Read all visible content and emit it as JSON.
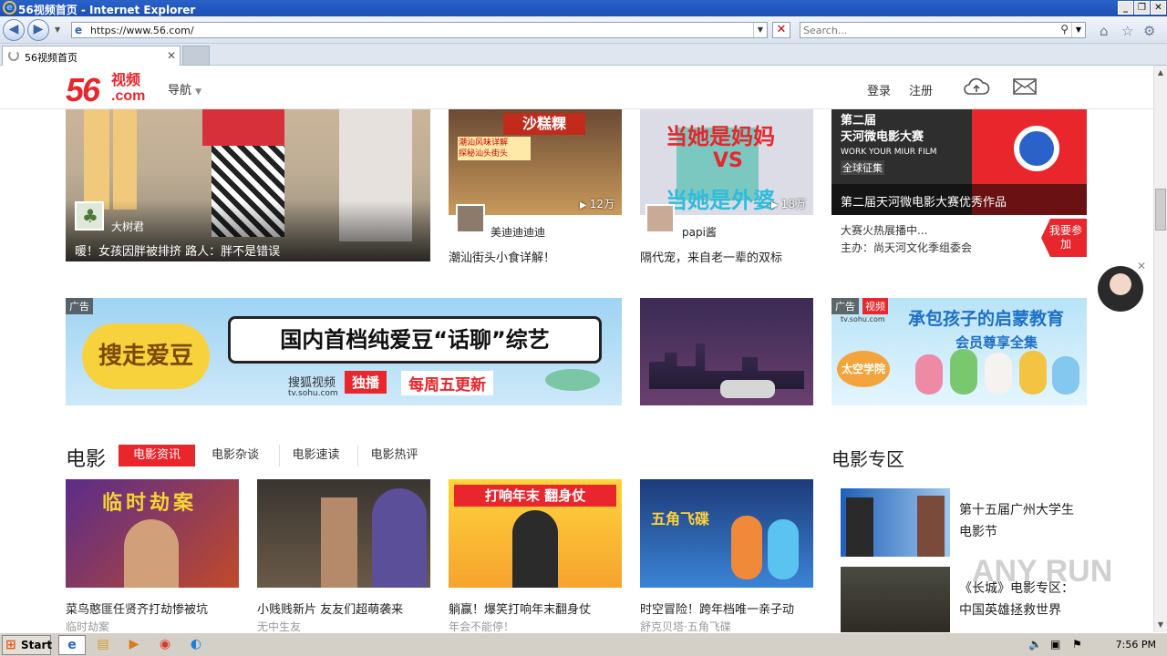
{
  "window": {
    "title": "56视频首页 - Internet Explorer"
  },
  "browser": {
    "url": "https://www.56.com/",
    "search_placeholder": "Search...",
    "tab_title": "56视频首页"
  },
  "site": {
    "logo_num": "56",
    "logo_cn": "视频",
    "logo_dom": ".com",
    "nav_label": "导航",
    "login": "登录",
    "register": "注册"
  },
  "top_row": {
    "big": {
      "user": "大树君",
      "title": "暖！女孩因胖被排挤 路人：胖不是错误"
    },
    "card2": {
      "views": "12万",
      "user": "美迪迪迪迪",
      "title": "潮汕街头小食详解！",
      "banner_text": "沙糕粿"
    },
    "card3": {
      "views": "18万",
      "user": "papi酱",
      "title": "隔代宠，来自老一辈的双标"
    },
    "card4": {
      "overlay": "第二届天河微电影大赛优秀作品",
      "line1": "大赛火热展播中...",
      "line2": "主办：尚天河文化季组委会",
      "btn": "我要参加",
      "poster_title": "第二届\n天河微电影大赛",
      "poster_en": "WORK YOUR MIUR FILM",
      "poster_sub": "全球征集"
    }
  },
  "ads": {
    "tag": "广告",
    "banner1": {
      "title": "国内首档纯爱豆“话聊”综艺",
      "logo": "搜狐视频",
      "exclusive": "独播",
      "weekly": "每周五更新",
      "domain": "tv.sohu.com",
      "left_text": "搜走爱豆"
    },
    "banner3": {
      "title": "承包孩子的启蒙教育",
      "sub": "会员尊享全集",
      "domain": "tv.sohu.com",
      "logo": "视频",
      "badge": "太空学院"
    }
  },
  "movie": {
    "heading": "电影",
    "tabs": [
      "电影资讯",
      "电影杂谈",
      "电影速读",
      "电影热评"
    ],
    "cards": [
      {
        "title": "菜鸟憨匪任贤齐打劫惨被坑",
        "sub": "临时劫案",
        "poster": "临时劫案"
      },
      {
        "title": "小贱贱新片 友友们超萌袭来",
        "sub": "无中生友",
        "poster": ""
      },
      {
        "title": "躺赢！爆笑打响年末翻身仗",
        "sub": "年会不能停！",
        "poster": "打响年末 翻身仗"
      },
      {
        "title": "时空冒险！跨年档唯一亲子动",
        "sub": "舒克贝塔·五角飞碟",
        "poster": "五角飞碟"
      }
    ],
    "special_heading": "电影专区",
    "special": [
      {
        "title": "第十五届广州大学生电影节"
      },
      {
        "title": "《长城》电影专区：中国英雄拯救世界"
      }
    ]
  },
  "taskbar": {
    "start": "Start",
    "time": "7:56 PM"
  },
  "watermark": "ANY RUN",
  "colors": {
    "brand_red": "#e8262b",
    "ie_blue": "#2a62c9"
  }
}
